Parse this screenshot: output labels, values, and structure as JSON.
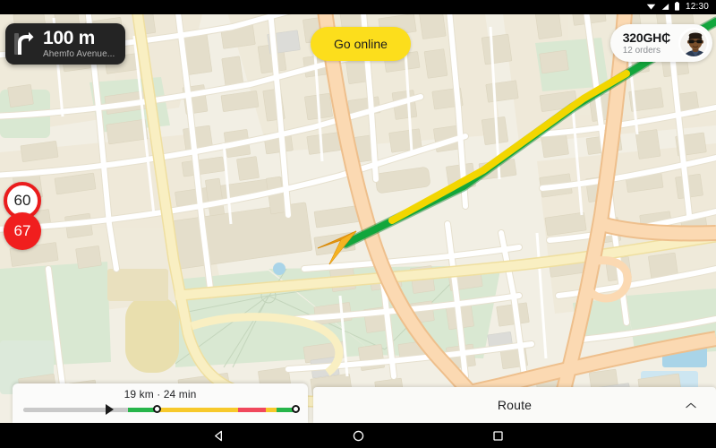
{
  "statusbar": {
    "time": "12:30",
    "icons": [
      "wifi-icon",
      "signal-icon",
      "battery-icon"
    ]
  },
  "navigation_card": {
    "maneuver_icon": "turn-right-icon",
    "distance": "100 m",
    "street": "Ahemfo Avenue..."
  },
  "go_online": {
    "label": "Go online",
    "color": "#FCDE1C"
  },
  "earnings": {
    "amount": "320GH₵",
    "orders": "12 orders",
    "avatar_icon": "driver-avatar"
  },
  "speed": {
    "limit": "60",
    "current": "67",
    "limit_ring_color": "#EA1C1C",
    "current_bg_color": "#F01E1E"
  },
  "eta": {
    "summary": "19 km · 24 min",
    "progress_percent": 38,
    "traffic_segments": [
      {
        "label": "traveled",
        "start": 0,
        "end": 38,
        "color": "#c9c9c9"
      },
      {
        "label": "free-flow",
        "start": 38,
        "end": 49,
        "color": "#27B54A"
      },
      {
        "label": "moderate",
        "start": 50,
        "end": 78,
        "color": "#F7C92B"
      },
      {
        "label": "heavy",
        "start": 78,
        "end": 88,
        "color": "#F0485C"
      },
      {
        "label": "moderate-2",
        "start": 88,
        "end": 92,
        "color": "#F7C92B"
      },
      {
        "label": "free-flow-2",
        "start": 92,
        "end": 100,
        "color": "#27B54A"
      }
    ]
  },
  "route_panel": {
    "label": "Route",
    "expand_icon": "chevron-up-icon"
  },
  "android_nav": {
    "back": "back-icon",
    "home": "home-icon",
    "recents": "recents-icon"
  },
  "map": {
    "base_color": "#F2EFE4",
    "road_white": "#FFFFFF",
    "road_yellow": "#F7E9A8",
    "road_orange": "#F9CE9B",
    "park_green": "#D8E8D0",
    "building": "#E5E0CE",
    "water": "#A9D4E8",
    "route_green": "#12A63C",
    "route_yellow": "#F2D600",
    "vehicle_marker": "#F0A81E"
  }
}
